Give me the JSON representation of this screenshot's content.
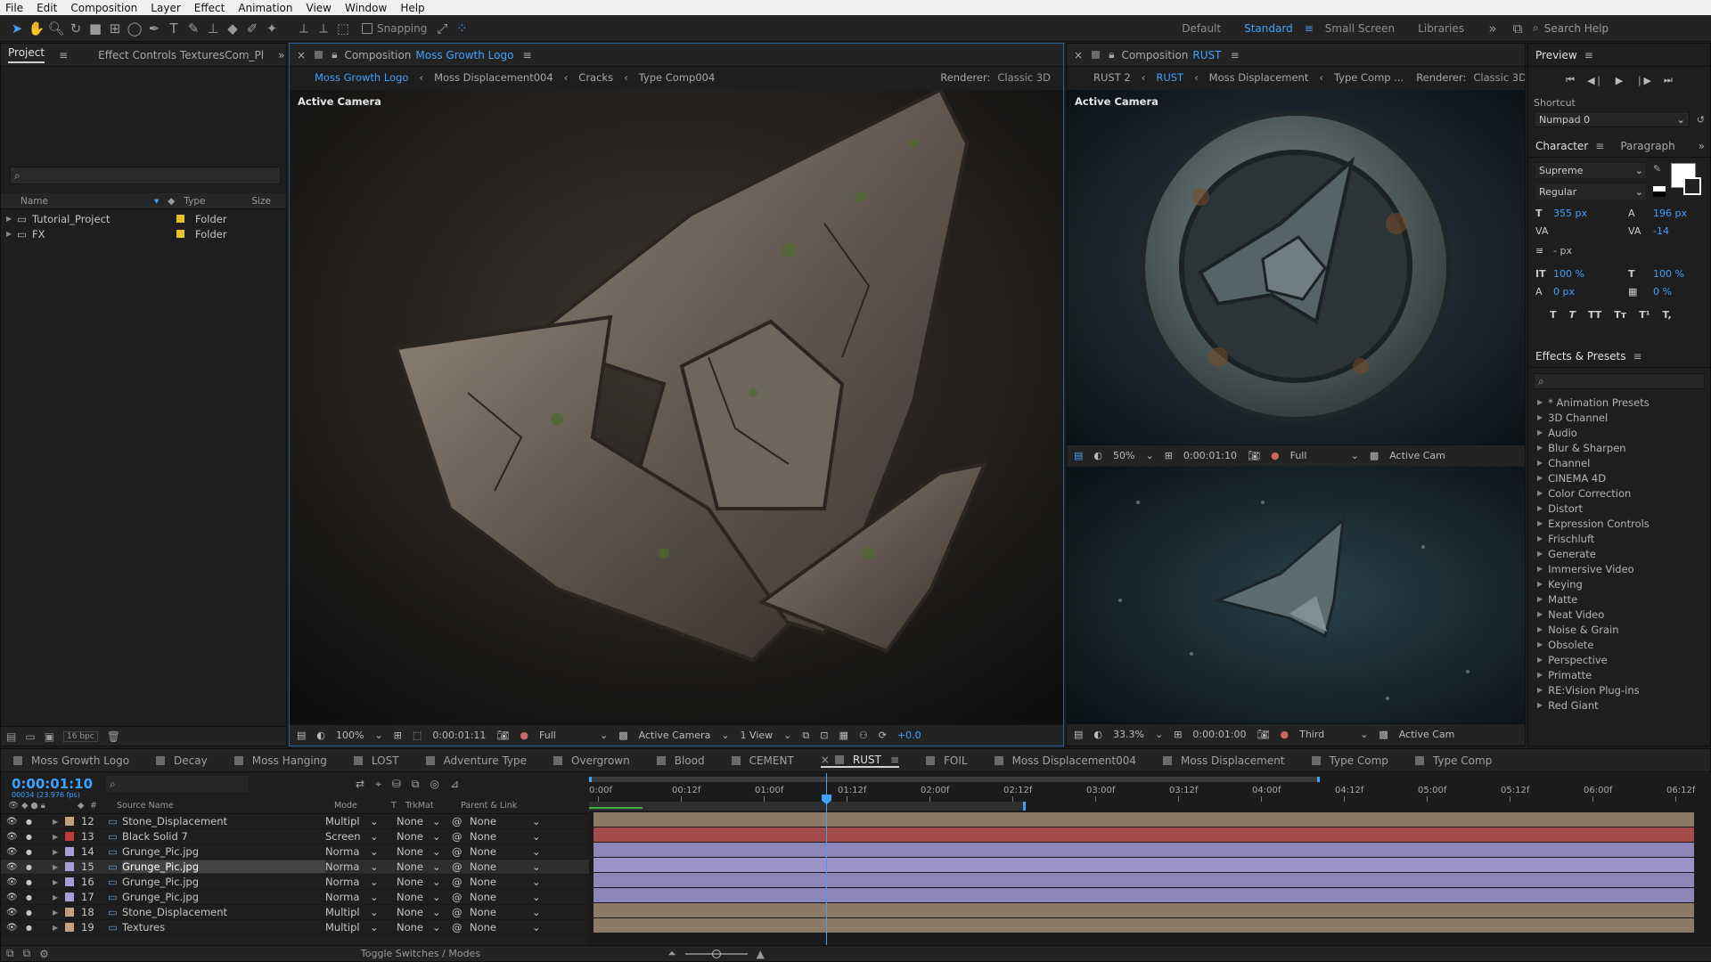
{
  "menu": [
    "File",
    "Edit",
    "Composition",
    "Layer",
    "Effect",
    "Animation",
    "View",
    "Window",
    "Help"
  ],
  "toolbar": {
    "snapping_label": "Snapping",
    "workspaces": [
      "Default",
      "Standard",
      "Small Screen",
      "Libraries"
    ],
    "active_workspace": "Standard",
    "search_placeholder": "Search Help"
  },
  "project_panel": {
    "tabs": [
      "Project",
      "Effect Controls TexturesCom_Pl"
    ],
    "columns": [
      "Name",
      "Type",
      "Size"
    ],
    "items": [
      {
        "name": "Tutorial_Project",
        "type": "Folder"
      },
      {
        "name": "FX",
        "type": "Folder"
      }
    ],
    "bit_depth": "16 bpc"
  },
  "comp_left": {
    "header": "Composition",
    "name": "Moss Growth Logo",
    "breadcrumbs": [
      "Moss Growth Logo",
      "Moss Displacement004",
      "Cracks",
      "Type Comp004"
    ],
    "renderer_label": "Renderer:",
    "renderer": "Classic 3D",
    "camera_label": "Active Camera",
    "zoom": "100%",
    "timecode": "0:00:01:11",
    "quality": "Full",
    "camera": "Active Camera",
    "views": "1 View",
    "exposure": "+0.0"
  },
  "comp_right": {
    "header": "Composition",
    "name": "RUST",
    "breadcrumbs": [
      "RUST 2",
      "RUST",
      "Moss Displacement",
      "Type Comp ..."
    ],
    "renderer_label": "Renderer:",
    "renderer": "Classic 3D",
    "camera_label": "Active Camera",
    "zoom_top": "50%",
    "timecode_top": "0:00:01:10",
    "quality_top": "Full",
    "camera_top": "Active Cam",
    "zoom_bottom": "33.3%",
    "timecode_bottom": "0:00:01:00",
    "quality_bottom": "Third",
    "camera_bottom": "Active Cam"
  },
  "preview_panel": {
    "title": "Preview",
    "shortcut_label": "Shortcut",
    "shortcut_value": "Numpad 0"
  },
  "character_panel": {
    "tabs": [
      "Character",
      "Paragraph"
    ],
    "font": "Supreme",
    "style": "Regular",
    "size": "355 px",
    "leading": "196 px",
    "tracking": "-14",
    "stroke": "- px",
    "vscale": "100 %",
    "hscale": "100 %",
    "baseline": "0 px",
    "tsume": "0 %",
    "style_buttons": [
      "T",
      "T",
      "TT",
      "Tт",
      "T¹",
      "T,"
    ]
  },
  "effects_panel": {
    "title": "Effects & Presets",
    "items": [
      "* Animation Presets",
      "3D Channel",
      "Audio",
      "Blur & Sharpen",
      "Channel",
      "CINEMA 4D",
      "Color Correction",
      "Distort",
      "Expression Controls",
      "Frischluft",
      "Generate",
      "Immersive Video",
      "Keying",
      "Matte",
      "Neat Video",
      "Noise & Grain",
      "Obsolete",
      "Perspective",
      "Primatte",
      "RE:Vision Plug-ins",
      "Red Giant"
    ]
  },
  "timeline": {
    "tabs": [
      {
        "name": "Moss Growth Logo",
        "color": "#6b6b6b"
      },
      {
        "name": "Decay",
        "color": "#6b6b6b"
      },
      {
        "name": "Moss Hanging",
        "color": "#6b6b6b"
      },
      {
        "name": "LOST",
        "color": "#6b6b6b"
      },
      {
        "name": "Adventure Type",
        "color": "#6b6b6b"
      },
      {
        "name": "Overgrown",
        "color": "#6b6b6b"
      },
      {
        "name": "Blood",
        "color": "#6b6b6b"
      },
      {
        "name": "CEMENT",
        "color": "#6b6b6b"
      },
      {
        "name": "RUST",
        "color": "#6b6b6b"
      },
      {
        "name": "FOIL",
        "color": "#6b6b6b"
      },
      {
        "name": "Moss Displacement004",
        "color": "#6b6b6b"
      },
      {
        "name": "Moss Displacement",
        "color": "#6b6b6b"
      },
      {
        "name": "Type Comp",
        "color": "#6b6b6b"
      },
      {
        "name": "Type Comp",
        "color": "#6b6b6b"
      }
    ],
    "active_tab": "RUST",
    "timecode": "0:00:01:10",
    "fps": "00034 (23.976 fps)",
    "columns": [
      "#",
      "Source Name",
      "Mode",
      "T",
      "TrkMat",
      "Parent & Link"
    ],
    "ruler": [
      "0:00f",
      "00:12f",
      "01:00f",
      "01:12f",
      "02:00f",
      "02:12f",
      "03:00f",
      "03:12f",
      "04:00f",
      "04:12f",
      "05:00f",
      "05:12f",
      "06:00f",
      "06:12f"
    ],
    "layers": [
      {
        "num": "12",
        "name": "Stone_Displacement",
        "mode": "Multipl",
        "trk": "None",
        "parent": "None",
        "label": "#c2a183",
        "bar": "#8a7a66"
      },
      {
        "num": "13",
        "name": "Black Solid 7",
        "mode": "Screen",
        "trk": "None",
        "parent": "None",
        "label": "#c23a3a",
        "bar": "#a34a4a"
      },
      {
        "num": "14",
        "name": "Grunge_Pic.jpg",
        "mode": "Norma",
        "trk": "None",
        "parent": "None",
        "label": "#a99dd6",
        "bar": "#8c86b8"
      },
      {
        "num": "15",
        "name": "Grunge_Pic.jpg",
        "mode": "Norma",
        "trk": "None",
        "parent": "None",
        "label": "#a99dd6",
        "bar": "#9a94c8"
      },
      {
        "num": "16",
        "name": "Grunge_Pic.jpg",
        "mode": "Norma",
        "trk": "None",
        "parent": "None",
        "label": "#a99dd6",
        "bar": "#8c86b8"
      },
      {
        "num": "17",
        "name": "Grunge_Pic.jpg",
        "mode": "Norma",
        "trk": "None",
        "parent": "None",
        "label": "#a99dd6",
        "bar": "#8c86b8"
      },
      {
        "num": "18",
        "name": "Stone_Displacement",
        "mode": "Multipl",
        "trk": "None",
        "parent": "None",
        "label": "#c2a183",
        "bar": "#8a7a66"
      },
      {
        "num": "19",
        "name": "Textures",
        "mode": "Multipl",
        "trk": "None",
        "parent": "None",
        "label": "#c2a183",
        "bar": "#8a7a66"
      }
    ],
    "toggle_label": "Toggle Switches / Modes"
  }
}
